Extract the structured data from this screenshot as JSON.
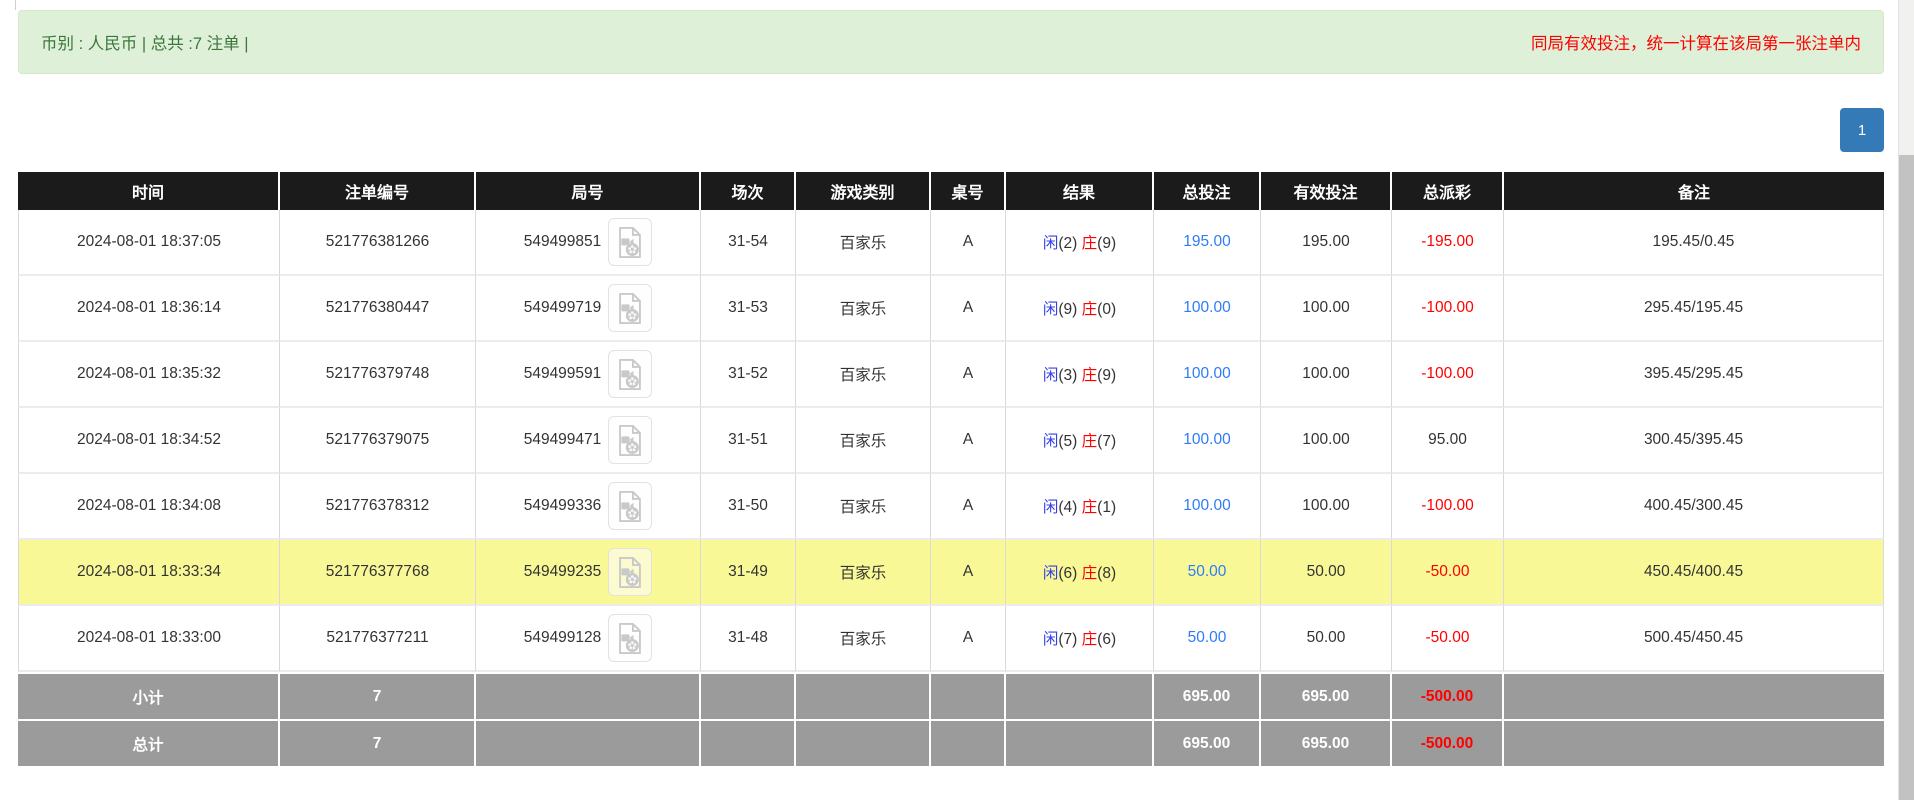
{
  "alert": {
    "summary": "币别 : 人民币 | 总共 :7 注单 |",
    "notice": "同局有效投注，统一计算在该局第一张注单内"
  },
  "pagination": {
    "current_page": "1"
  },
  "table": {
    "headers": [
      "时间",
      "注单编号",
      "局号",
      "场次",
      "游戏类别",
      "桌号",
      "结果",
      "总投注",
      "有效投注",
      "总派彩",
      "备注"
    ],
    "rows": [
      {
        "time": "2024-08-01 18:37:05",
        "bet_id": "521776381266",
        "round_id": "549499851",
        "session": "31-54",
        "game": "百家乐",
        "table_code": "A",
        "player_label": "闲",
        "player_score": "(2)",
        "banker_label": "庄",
        "banker_score": "(9)",
        "total_bet": "195.00",
        "valid_bet": "195.00",
        "payout": "-195.00",
        "remark": "195.45/0.45",
        "highlight": false
      },
      {
        "time": "2024-08-01 18:36:14",
        "bet_id": "521776380447",
        "round_id": "549499719",
        "session": "31-53",
        "game": "百家乐",
        "table_code": "A",
        "player_label": "闲",
        "player_score": "(9)",
        "banker_label": "庄",
        "banker_score": "(0)",
        "total_bet": "100.00",
        "valid_bet": "100.00",
        "payout": "-100.00",
        "remark": "295.45/195.45",
        "highlight": false
      },
      {
        "time": "2024-08-01 18:35:32",
        "bet_id": "521776379748",
        "round_id": "549499591",
        "session": "31-52",
        "game": "百家乐",
        "table_code": "A",
        "player_label": "闲",
        "player_score": "(3)",
        "banker_label": "庄",
        "banker_score": "(9)",
        "total_bet": "100.00",
        "valid_bet": "100.00",
        "payout": "-100.00",
        "remark": "395.45/295.45",
        "highlight": false
      },
      {
        "time": "2024-08-01 18:34:52",
        "bet_id": "521776379075",
        "round_id": "549499471",
        "session": "31-51",
        "game": "百家乐",
        "table_code": "A",
        "player_label": "闲",
        "player_score": "(5)",
        "banker_label": "庄",
        "banker_score": "(7)",
        "total_bet": "100.00",
        "valid_bet": "100.00",
        "payout": "95.00",
        "remark": "300.45/395.45",
        "highlight": false
      },
      {
        "time": "2024-08-01 18:34:08",
        "bet_id": "521776378312",
        "round_id": "549499336",
        "session": "31-50",
        "game": "百家乐",
        "table_code": "A",
        "player_label": "闲",
        "player_score": "(4)",
        "banker_label": "庄",
        "banker_score": "(1)",
        "total_bet": "100.00",
        "valid_bet": "100.00",
        "payout": "-100.00",
        "remark": "400.45/300.45",
        "highlight": false
      },
      {
        "time": "2024-08-01 18:33:34",
        "bet_id": "521776377768",
        "round_id": "549499235",
        "session": "31-49",
        "game": "百家乐",
        "table_code": "A",
        "player_label": "闲",
        "player_score": "(6)",
        "banker_label": "庄",
        "banker_score": "(8)",
        "total_bet": "50.00",
        "valid_bet": "50.00",
        "payout": "-50.00",
        "remark": "450.45/400.45",
        "highlight": true
      },
      {
        "time": "2024-08-01 18:33:00",
        "bet_id": "521776377211",
        "round_id": "549499128",
        "session": "31-48",
        "game": "百家乐",
        "table_code": "A",
        "player_label": "闲",
        "player_score": "(7)",
        "banker_label": "庄",
        "banker_score": "(6)",
        "total_bet": "50.00",
        "valid_bet": "50.00",
        "payout": "-50.00",
        "remark": "500.45/450.45",
        "highlight": false
      }
    ],
    "subtotal": {
      "label": "小计",
      "bet_count": "7",
      "total_bet": "695.00",
      "valid_bet": "695.00",
      "payout": "-500.00"
    },
    "grand_total": {
      "label": "总计",
      "bet_count": "7",
      "total_bet": "695.00",
      "valid_bet": "695.00",
      "payout": "-500.00"
    }
  },
  "colors": {
    "alert_bg": "#dff0d8",
    "alert_border": "#d6e9c6",
    "alert_text": "#3c763d",
    "notice_red": "#ff0000",
    "pagination_blue": "#337ab7",
    "header_bg": "#1b1b1b",
    "footer_bg": "#9b9b9b",
    "highlight_yellow": "#f9f897",
    "player_blue": "#3340e8",
    "banker_red": "#ff0000",
    "amount_link_blue": "#2e7cf6",
    "negative_red": "#ff0000"
  }
}
